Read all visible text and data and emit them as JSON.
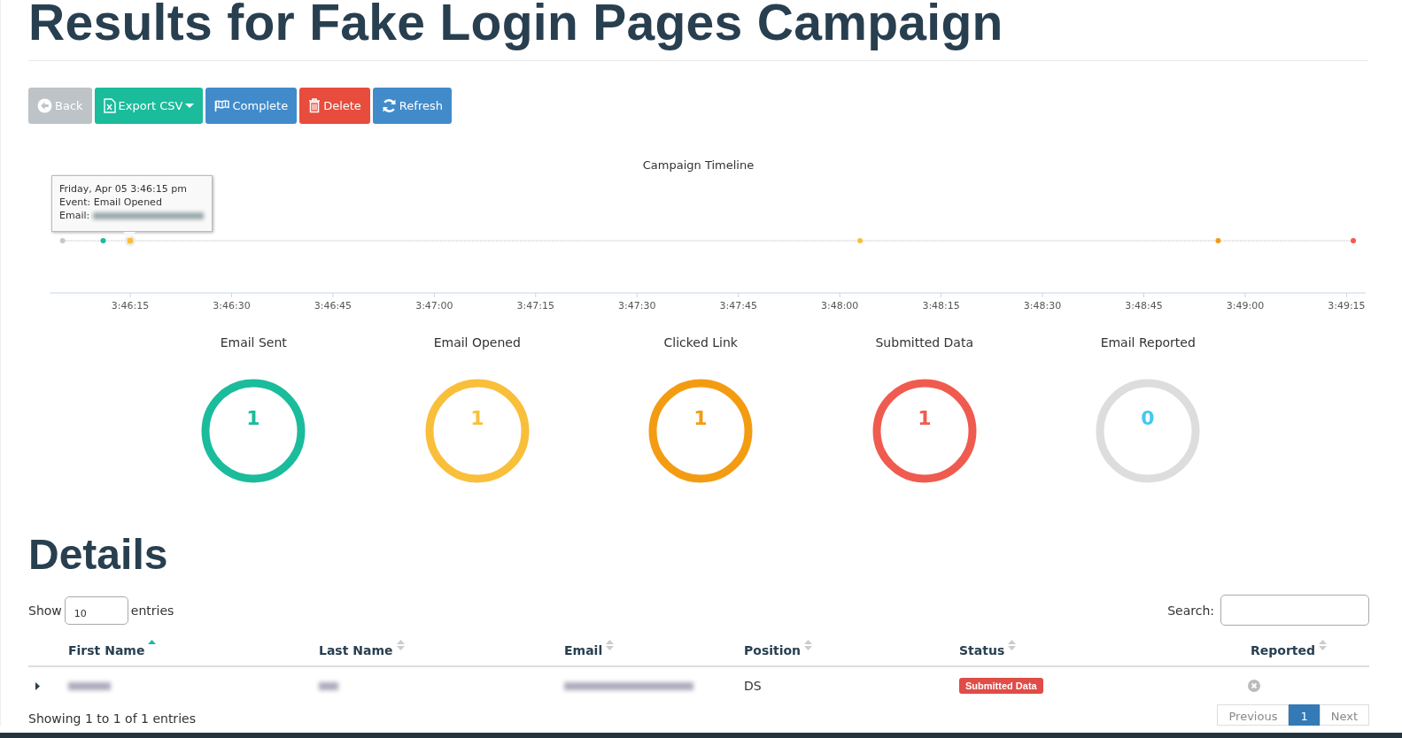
{
  "page_title": "Results for Fake Login Pages Campaign",
  "buttons": [
    {
      "label": "Back",
      "kind": "back",
      "color": "#bdc3c7"
    },
    {
      "label": "Export CSV",
      "kind": "export",
      "color": "#1abc9c"
    },
    {
      "label": "Complete",
      "kind": "complete",
      "color": "#428bca"
    },
    {
      "label": "Delete",
      "kind": "delete",
      "color": "#e74c3c"
    },
    {
      "label": "Refresh",
      "kind": "refresh",
      "color": "#428bca"
    }
  ],
  "timeline": {
    "title": "Campaign Timeline",
    "events": [
      {
        "color": "#c8c8c8",
        "selected": false
      },
      {
        "color": "#1abc9c",
        "selected": false
      },
      {
        "color": "#f9bf3b",
        "selected": true
      },
      {
        "color": "#f9bf3b",
        "selected": false
      },
      {
        "color": "#f39c12",
        "selected": false
      },
      {
        "color": "#f05b4f",
        "selected": false
      }
    ],
    "tick_labels": [
      "3:46:15",
      "3:46:30",
      "3:46:45",
      "3:47:00",
      "3:47:15",
      "3:47:30",
      "3:47:45",
      "3:48:00",
      "3:48:15",
      "3:48:30",
      "3:48:45",
      "3:49:00",
      "3:49:15"
    ],
    "tooltip": {
      "date": "Friday, Apr 05 3:46:15 pm",
      "event": "Event: Email Opened",
      "email_label": "Email:",
      "email_redacted": true
    }
  },
  "stats": [
    {
      "label": "Email Sent",
      "count": "1",
      "active": true,
      "color": "#1abc9c"
    },
    {
      "label": "Email Opened",
      "count": "1",
      "active": true,
      "color": "#f9bf3b"
    },
    {
      "label": "Clicked Link",
      "count": "1",
      "active": true,
      "color": "#f39c12"
    },
    {
      "label": "Submitted Data",
      "count": "1",
      "active": true,
      "color": "#f05b4f"
    },
    {
      "label": "Email Reported",
      "count": "0",
      "active": false,
      "color": "#45c8f0"
    }
  ],
  "details": {
    "title": "Details",
    "show_label": "Show",
    "entries_value": "10",
    "entries_label": "entries",
    "search_label": "Search:",
    "columns": [
      {
        "label": "First Name",
        "sorted": true
      },
      {
        "label": "Last Name",
        "sorted": false
      },
      {
        "label": "Email",
        "sorted": false
      },
      {
        "label": "Position",
        "sorted": false
      },
      {
        "label": "Status",
        "sorted": false
      },
      {
        "label": "Reported",
        "sorted": false
      }
    ],
    "rows": [
      {
        "expanded": false,
        "first_name_redacted": true,
        "last_name_redacted": true,
        "email_redacted": true,
        "position": "DS",
        "status": "Submitted Data",
        "color": "#e04c48",
        "reported": false
      }
    ],
    "info": "Showing 1 to 1 of 1 entries",
    "pages": [
      {
        "label": "Previous",
        "selected": false
      },
      {
        "label": "1",
        "selected": true
      },
      {
        "label": "Next",
        "selected": false
      }
    ]
  }
}
